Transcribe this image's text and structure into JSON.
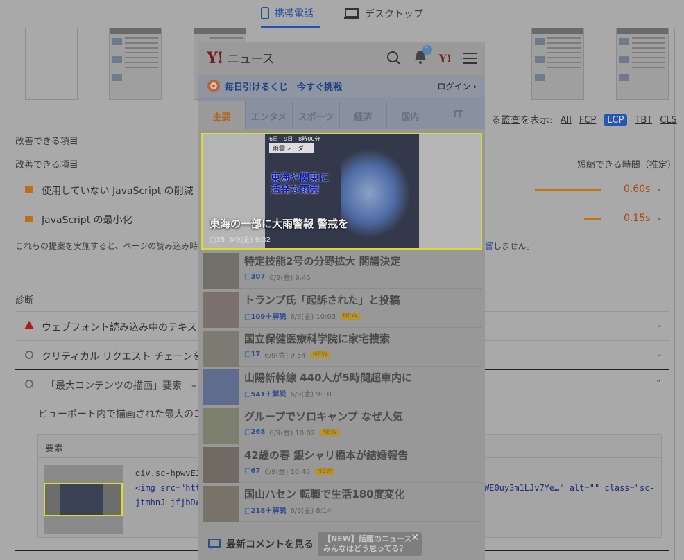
{
  "tabs": {
    "mobile": "携帯電話",
    "desktop": "デスクトップ"
  },
  "audit_filter": {
    "label": "る監査を表示:",
    "options": [
      "All",
      "FCP",
      "LCP",
      "TBT",
      "CLS"
    ],
    "active": "LCP"
  },
  "opportunities": {
    "section_title": "改善できる項目",
    "col_left": "改善できる項目",
    "col_right": "短縮できる時間（推定）",
    "items": [
      {
        "label": "使用していない JavaScript の削減",
        "value": "0.60s",
        "bar_fraction": 0.72
      },
      {
        "label": "JavaScript の最小化",
        "value": "0.15s",
        "bar_fraction": 0.18
      }
    ],
    "note_left": "これらの提案を実施すると、ページの読み込み時",
    "note_link": "響",
    "note_right": "しません。"
  },
  "diagnostics": {
    "section_title": "診断",
    "items": [
      {
        "label": "ウェブフォント読み込み中のテキス"
      },
      {
        "label": "クリティカル リクエスト チェーンを"
      },
      {
        "label": "「最大コンテンツの描画」要素　–"
      }
    ],
    "lcp_desc": "ビューポート内で描画された最大のコ",
    "table_header": "要素",
    "selector": "div.sc-hpwvEJ >",
    "code_line1_a": "<img src=\"htt",
    "code_line1_b": "WE0uy3m1LJv7Ye…\" alt=\"\" class=\"sc-",
    "code_line2": "jtmhnJ jfjbDW"
  },
  "mobile": {
    "logo": "Y!",
    "logo_text": "ニュース",
    "notif_count": "1",
    "lottery": "毎日引けるくじ　今すぐ挑戦",
    "login": "ログイン",
    "nav": [
      "主要",
      "エンタメ",
      "スポーツ",
      "経済",
      "国内",
      "IT"
    ],
    "nav_active": "主要",
    "hero": {
      "time": "6日　9日　8時00分",
      "radar_tag": "雨雲レーダー",
      "caption": [
        "東海や関東に",
        "活発な雨雲"
      ],
      "title": "東海の一部に大雨警報 警戒を",
      "comments": "35",
      "date": "6/9(金) 9:32"
    },
    "news": [
      {
        "title": "特定技能2号の分野拡大 閣議決定",
        "comments": "307",
        "date": "6/9(金) 9:45",
        "tag": ""
      },
      {
        "title": "トランプ氏「起訴された」と投稿",
        "comments": "109＋解説",
        "date": "6/9(金) 10:03",
        "tag": "NEW"
      },
      {
        "title": "国立保健医療科学院に家宅捜索",
        "comments": "17",
        "date": "6/9(金) 9:54",
        "tag": "NEW"
      },
      {
        "title": "山陽新幹線 440人が5時間超車内に",
        "comments": "541＋解説",
        "date": "6/9(金) 9:10",
        "tag": ""
      },
      {
        "title": "グループでソロキャンプ なぜ人気",
        "comments": "268",
        "date": "6/9(金) 10:02",
        "tag": "NEW"
      },
      {
        "title": "42歳の春 銀シャリ橋本が結婚報告",
        "comments": "67",
        "date": "6/9(金) 10:40",
        "tag": "NEW"
      },
      {
        "title": "国山ハセン 転職で生活180度変化",
        "comments": "218＋解説",
        "date": "6/9(金) 8:14",
        "tag": ""
      }
    ],
    "footer_link": "最新コメントを見る",
    "bubble": [
      "【NEW】話題のニュース",
      "みんなはどう思ってる？"
    ]
  }
}
